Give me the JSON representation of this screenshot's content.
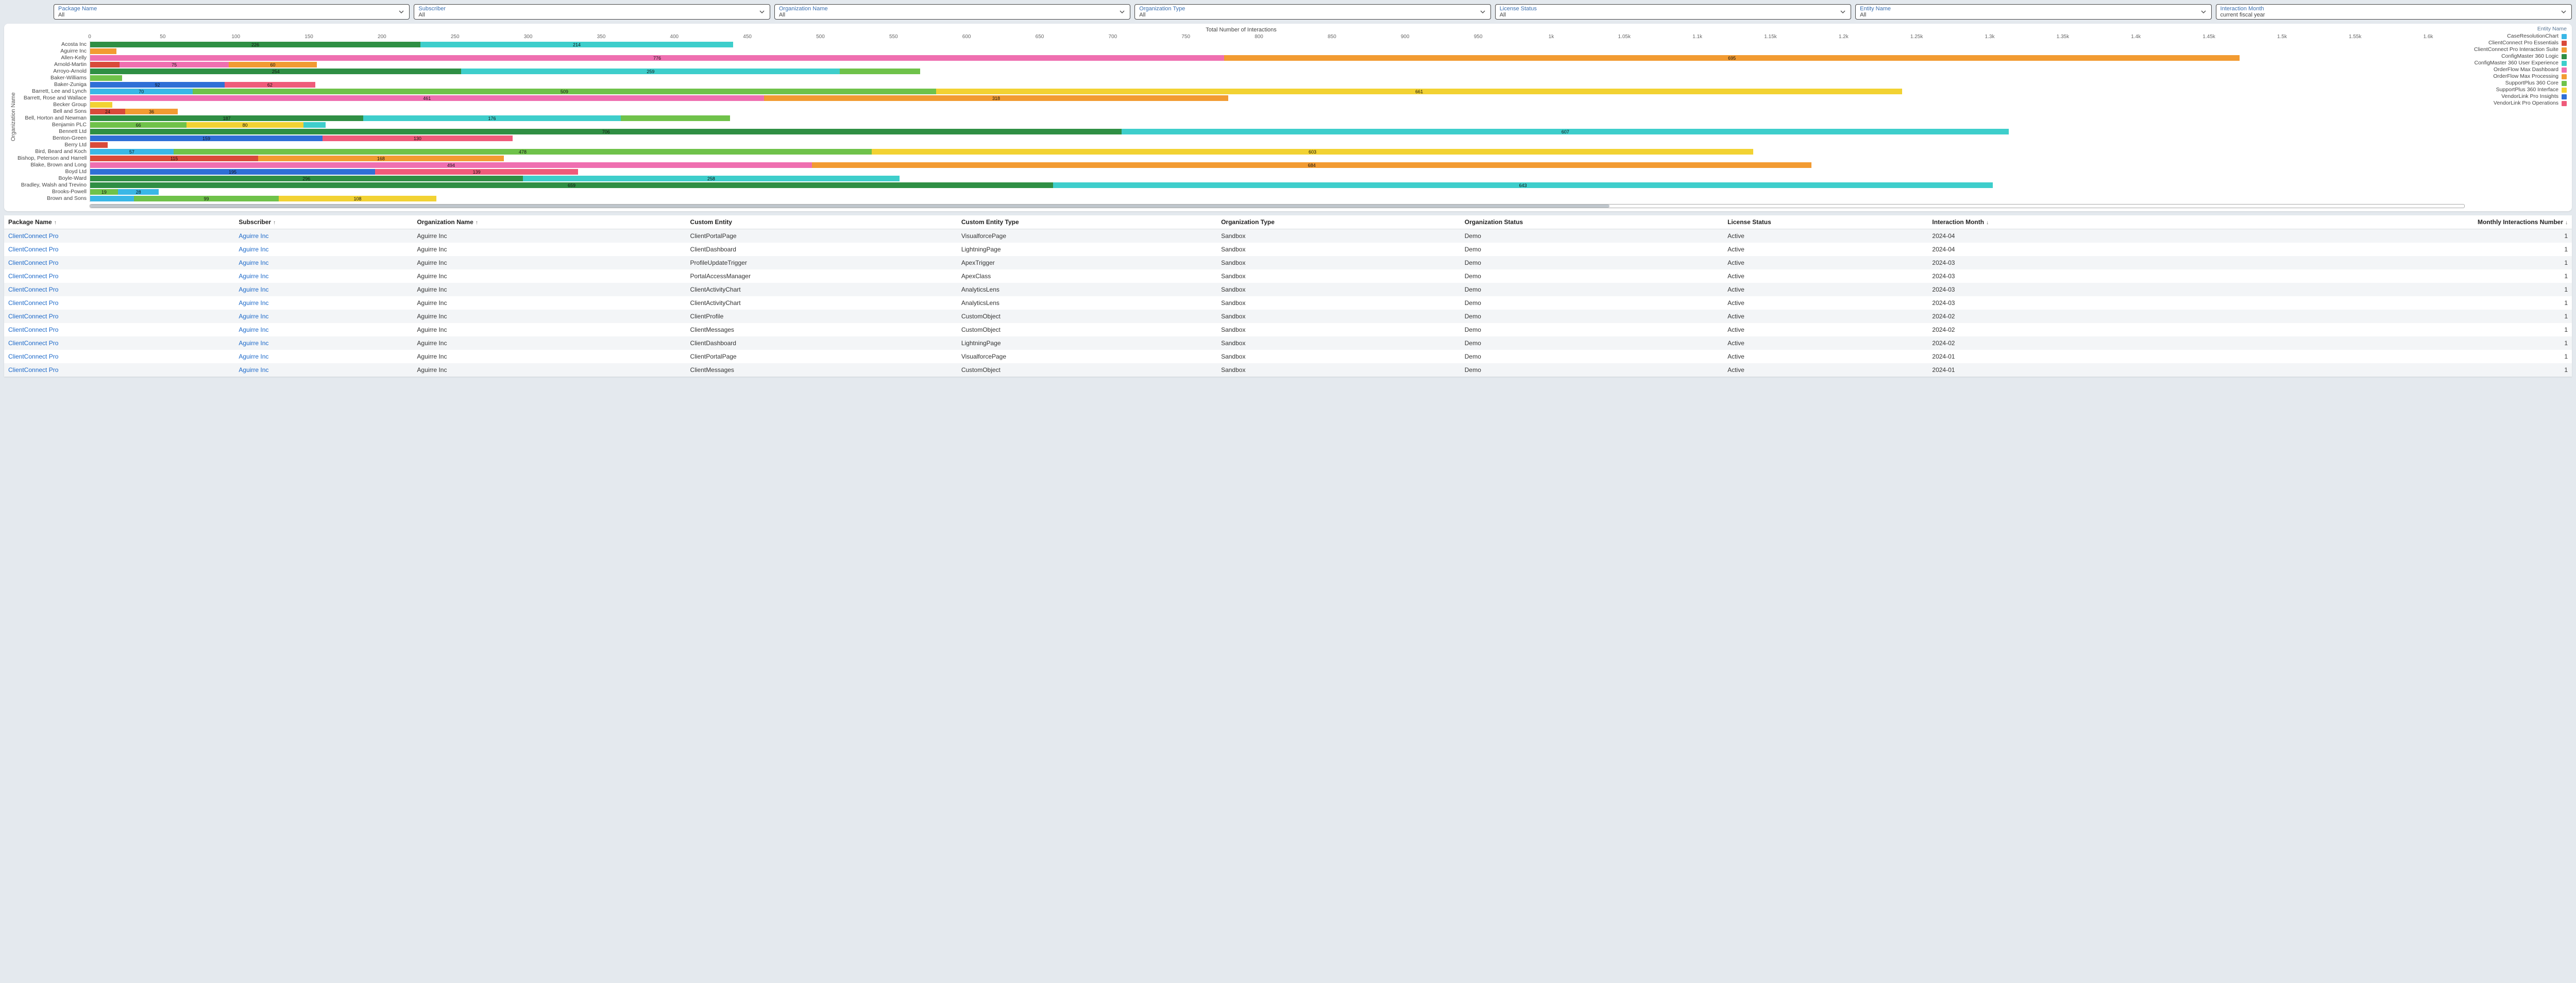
{
  "filters": [
    {
      "label": "Package Name",
      "value": "All"
    },
    {
      "label": "Subscriber",
      "value": "All"
    },
    {
      "label": "Organization Name",
      "value": "All"
    },
    {
      "label": "Organization Type",
      "value": "All"
    },
    {
      "label": "License Status",
      "value": "All"
    },
    {
      "label": "Entity Name",
      "value": "All"
    },
    {
      "label": "Interaction Month",
      "value": "current fiscal year"
    }
  ],
  "chart_data": {
    "type": "bar",
    "orientation": "horizontal",
    "stacked": true,
    "title": "Total Number of Interactions",
    "ylabel": "Organization Name",
    "xlim": [
      0,
      1625
    ],
    "ticks": [
      0,
      50,
      100,
      150,
      200,
      250,
      300,
      350,
      400,
      450,
      500,
      550,
      600,
      650,
      700,
      750,
      800,
      850,
      900,
      950,
      "1k",
      "1.05k",
      "1.1k",
      "1.15k",
      "1.2k",
      "1.25k",
      "1.3k",
      "1.35k",
      "1.4k",
      "1.45k",
      "1.5k",
      "1.55k",
      "1.6k"
    ],
    "tick_values": [
      0,
      50,
      100,
      150,
      200,
      250,
      300,
      350,
      400,
      450,
      500,
      550,
      600,
      650,
      700,
      750,
      800,
      850,
      900,
      950,
      1000,
      1050,
      1100,
      1150,
      1200,
      1250,
      1300,
      1350,
      1400,
      1450,
      1500,
      1550,
      1600
    ],
    "legend_title": "Entity Name",
    "legend": [
      {
        "name": "CaseResolutionChart",
        "color": "#3ab7e6"
      },
      {
        "name": "ClientConnect Pro Essentials",
        "color": "#d94a3a"
      },
      {
        "name": "ClientConnect Pro Interaction Suite",
        "color": "#f29b32"
      },
      {
        "name": "ConfigMaster 360 Logic",
        "color": "#2f8f44"
      },
      {
        "name": "ConfigMaster 360 User Experience",
        "color": "#3ececb"
      },
      {
        "name": "OrderFlow Max Dashboard",
        "color": "#ef6fb0"
      },
      {
        "name": "OrderFlow Max Processing",
        "color": "#f29b32"
      },
      {
        "name": "SupportPlus 360 Core",
        "color": "#6fc24a"
      },
      {
        "name": "SupportPlus 360 Interface",
        "color": "#f2d233"
      },
      {
        "name": "VendorLink Pro Insights",
        "color": "#2f6fd6"
      },
      {
        "name": "VendorLink Pro Operations",
        "color": "#ef5b7a"
      }
    ],
    "categories": [
      "Acosta Inc",
      "Aguirre Inc",
      "Allen-Kelly",
      "Arnold-Martin",
      "Arroyo-Arnold",
      "Baker-Williams",
      "Baker-Zuniga",
      "Barrett, Lee and Lynch",
      "Barrett, Rose and Wallace",
      "Becker Group",
      "Bell and Sons",
      "Bell, Horton and Newman",
      "Benjamin PLC",
      "Bennett Ltd",
      "Benton-Green",
      "Berry Ltd",
      "Bird, Beard and Koch",
      "Bishop, Peterson and Harrell",
      "Blake, Brown and Long",
      "Boyd Ltd",
      "Boyle-Ward",
      "Bradley, Walsh and Trevino",
      "Brooks-Powell",
      "Brown and Sons"
    ],
    "rows": [
      {
        "org": "Acosta Inc",
        "segments": [
          {
            "color": "#2f8f44",
            "value": 226,
            "label": "226"
          },
          {
            "color": "#3ececb",
            "value": 214,
            "label": "214"
          }
        ]
      },
      {
        "org": "Aguirre Inc",
        "segments": [
          {
            "color": "#f29b32",
            "value": 18,
            "label": ""
          }
        ]
      },
      {
        "org": "Allen-Kelly",
        "segments": [
          {
            "color": "#ef6fb0",
            "value": 776,
            "label": "776"
          },
          {
            "color": "#f29b32",
            "value": 695,
            "label": "695"
          }
        ]
      },
      {
        "org": "Arnold-Martin",
        "segments": [
          {
            "color": "#d94a3a",
            "value": 20,
            "label": ""
          },
          {
            "color": "#ef6fb0",
            "value": 75,
            "label": "75"
          },
          {
            "color": "#f29b32",
            "value": 60,
            "label": "60"
          }
        ]
      },
      {
        "org": "Arroyo-Arnold",
        "segments": [
          {
            "color": "#2f8f44",
            "value": 254,
            "label": "254"
          },
          {
            "color": "#3ececb",
            "value": 259,
            "label": "259"
          },
          {
            "color": "#6fc24a",
            "value": 55,
            "label": ""
          }
        ]
      },
      {
        "org": "Baker-Williams",
        "segments": [
          {
            "color": "#6fc24a",
            "value": 22,
            "label": ""
          }
        ]
      },
      {
        "org": "Baker-Zuniga",
        "segments": [
          {
            "color": "#2f6fd6",
            "value": 92,
            "label": "92"
          },
          {
            "color": "#ef5b7a",
            "value": 62,
            "label": "62"
          }
        ]
      },
      {
        "org": "Barrett, Lee and Lynch",
        "segments": [
          {
            "color": "#3ab7e6",
            "value": 70,
            "label": "70"
          },
          {
            "color": "#6fc24a",
            "value": 509,
            "label": "509"
          },
          {
            "color": "#f2d233",
            "value": 661,
            "label": "661"
          }
        ]
      },
      {
        "org": "Barrett, Rose and Wallace",
        "segments": [
          {
            "color": "#ef6fb0",
            "value": 461,
            "label": "461"
          },
          {
            "color": "#f29b32",
            "value": 318,
            "label": "318"
          }
        ]
      },
      {
        "org": "Becker Group",
        "segments": [
          {
            "color": "#f2d233",
            "value": 15,
            "label": ""
          }
        ]
      },
      {
        "org": "Bell and Sons",
        "segments": [
          {
            "color": "#d94a3a",
            "value": 24,
            "label": "24"
          },
          {
            "color": "#f29b32",
            "value": 36,
            "label": "36"
          }
        ]
      },
      {
        "org": "Bell, Horton and Newman",
        "segments": [
          {
            "color": "#2f8f44",
            "value": 187,
            "label": "187"
          },
          {
            "color": "#3ececb",
            "value": 176,
            "label": "176"
          },
          {
            "color": "#6fc24a",
            "value": 75,
            "label": ""
          }
        ]
      },
      {
        "org": "Benjamin PLC",
        "segments": [
          {
            "color": "#6fc24a",
            "value": 66,
            "label": "66"
          },
          {
            "color": "#f2d233",
            "value": 80,
            "label": "80"
          },
          {
            "color": "#3ececb",
            "value": 15,
            "label": ""
          }
        ]
      },
      {
        "org": "Bennett Ltd",
        "segments": [
          {
            "color": "#2f8f44",
            "value": 706,
            "label": "706"
          },
          {
            "color": "#3ececb",
            "value": 607,
            "label": "607"
          }
        ]
      },
      {
        "org": "Benton-Green",
        "segments": [
          {
            "color": "#2f6fd6",
            "value": 159,
            "label": "159"
          },
          {
            "color": "#ef5b7a",
            "value": 130,
            "label": "130"
          }
        ]
      },
      {
        "org": "Berry Ltd",
        "segments": [
          {
            "color": "#d94a3a",
            "value": 12,
            "label": ""
          }
        ]
      },
      {
        "org": "Bird, Beard and Koch",
        "segments": [
          {
            "color": "#3ab7e6",
            "value": 57,
            "label": "57"
          },
          {
            "color": "#6fc24a",
            "value": 478,
            "label": "478"
          },
          {
            "color": "#f2d233",
            "value": 603,
            "label": "603"
          }
        ]
      },
      {
        "org": "Bishop, Peterson and Harrell",
        "segments": [
          {
            "color": "#d94a3a",
            "value": 115,
            "label": "115"
          },
          {
            "color": "#f29b32",
            "value": 168,
            "label": "168"
          }
        ]
      },
      {
        "org": "Blake, Brown and Long",
        "segments": [
          {
            "color": "#ef6fb0",
            "value": 494,
            "label": "494"
          },
          {
            "color": "#f29b32",
            "value": 684,
            "label": "684"
          }
        ]
      },
      {
        "org": "Boyd Ltd",
        "segments": [
          {
            "color": "#2f6fd6",
            "value": 195,
            "label": "195"
          },
          {
            "color": "#ef5b7a",
            "value": 139,
            "label": "139"
          }
        ]
      },
      {
        "org": "Boyle-Ward",
        "segments": [
          {
            "color": "#2f8f44",
            "value": 296,
            "label": "296"
          },
          {
            "color": "#3ececb",
            "value": 258,
            "label": "258"
          }
        ]
      },
      {
        "org": "Bradley, Walsh and Trevino",
        "segments": [
          {
            "color": "#2f8f44",
            "value": 659,
            "label": "659"
          },
          {
            "color": "#3ececb",
            "value": 643,
            "label": "643"
          }
        ]
      },
      {
        "org": "Brooks-Powell",
        "segments": [
          {
            "color": "#6fc24a",
            "value": 19,
            "label": "19"
          },
          {
            "color": "#3ab7e6",
            "value": 28,
            "label": "28"
          }
        ]
      },
      {
        "org": "Brown and Sons",
        "segments": [
          {
            "color": "#3ab7e6",
            "value": 30,
            "label": ""
          },
          {
            "color": "#6fc24a",
            "value": 99,
            "label": "99"
          },
          {
            "color": "#f2d233",
            "value": 108,
            "label": "108"
          }
        ]
      }
    ]
  },
  "table": {
    "columns": [
      {
        "label": "Package Name",
        "sort": "asc",
        "align": "left"
      },
      {
        "label": "Subscriber",
        "sort": "asc",
        "align": "left"
      },
      {
        "label": "Organization Name",
        "sort": "asc",
        "align": "left"
      },
      {
        "label": "Custom Entity",
        "sort": "",
        "align": "left"
      },
      {
        "label": "Custom Entity Type",
        "sort": "",
        "align": "left"
      },
      {
        "label": "Organization Type",
        "sort": "",
        "align": "left"
      },
      {
        "label": "Organization Status",
        "sort": "",
        "align": "left"
      },
      {
        "label": "License Status",
        "sort": "",
        "align": "left"
      },
      {
        "label": "Interaction Month",
        "sort": "desc",
        "align": "left"
      },
      {
        "label": "Monthly Interactions Number",
        "sort": "desc",
        "align": "right"
      }
    ],
    "rows": [
      {
        "package": "ClientConnect Pro",
        "subscriber": "Aguirre Inc",
        "org": "Aguirre Inc",
        "entity": "ClientPortalPage",
        "type": "VisualforcePage",
        "orgType": "Sandbox",
        "orgStatus": "Demo",
        "license": "Active",
        "month": "2024-04",
        "count": 1
      },
      {
        "package": "ClientConnect Pro",
        "subscriber": "Aguirre Inc",
        "org": "Aguirre Inc",
        "entity": "ClientDashboard",
        "type": "LightningPage",
        "orgType": "Sandbox",
        "orgStatus": "Demo",
        "license": "Active",
        "month": "2024-04",
        "count": 1
      },
      {
        "package": "ClientConnect Pro",
        "subscriber": "Aguirre Inc",
        "org": "Aguirre Inc",
        "entity": "ProfileUpdateTrigger",
        "type": "ApexTrigger",
        "orgType": "Sandbox",
        "orgStatus": "Demo",
        "license": "Active",
        "month": "2024-03",
        "count": 1
      },
      {
        "package": "ClientConnect Pro",
        "subscriber": "Aguirre Inc",
        "org": "Aguirre Inc",
        "entity": "PortalAccessManager",
        "type": "ApexClass",
        "orgType": "Sandbox",
        "orgStatus": "Demo",
        "license": "Active",
        "month": "2024-03",
        "count": 1
      },
      {
        "package": "ClientConnect Pro",
        "subscriber": "Aguirre Inc",
        "org": "Aguirre Inc",
        "entity": "ClientActivityChart",
        "type": "AnalyticsLens",
        "orgType": "Sandbox",
        "orgStatus": "Demo",
        "license": "Active",
        "month": "2024-03",
        "count": 1
      },
      {
        "package": "ClientConnect Pro",
        "subscriber": "Aguirre Inc",
        "org": "Aguirre Inc",
        "entity": "ClientActivityChart",
        "type": "AnalyticsLens",
        "orgType": "Sandbox",
        "orgStatus": "Demo",
        "license": "Active",
        "month": "2024-03",
        "count": 1
      },
      {
        "package": "ClientConnect Pro",
        "subscriber": "Aguirre Inc",
        "org": "Aguirre Inc",
        "entity": "ClientProfile",
        "type": "CustomObject",
        "orgType": "Sandbox",
        "orgStatus": "Demo",
        "license": "Active",
        "month": "2024-02",
        "count": 1
      },
      {
        "package": "ClientConnect Pro",
        "subscriber": "Aguirre Inc",
        "org": "Aguirre Inc",
        "entity": "ClientMessages",
        "type": "CustomObject",
        "orgType": "Sandbox",
        "orgStatus": "Demo",
        "license": "Active",
        "month": "2024-02",
        "count": 1
      },
      {
        "package": "ClientConnect Pro",
        "subscriber": "Aguirre Inc",
        "org": "Aguirre Inc",
        "entity": "ClientDashboard",
        "type": "LightningPage",
        "orgType": "Sandbox",
        "orgStatus": "Demo",
        "license": "Active",
        "month": "2024-02",
        "count": 1
      },
      {
        "package": "ClientConnect Pro",
        "subscriber": "Aguirre Inc",
        "org": "Aguirre Inc",
        "entity": "ClientPortalPage",
        "type": "VisualforcePage",
        "orgType": "Sandbox",
        "orgStatus": "Demo",
        "license": "Active",
        "month": "2024-01",
        "count": 1
      },
      {
        "package": "ClientConnect Pro",
        "subscriber": "Aguirre Inc",
        "org": "Aguirre Inc",
        "entity": "ClientMessages",
        "type": "CustomObject",
        "orgType": "Sandbox",
        "orgStatus": "Demo",
        "license": "Active",
        "month": "2024-01",
        "count": 1
      }
    ]
  }
}
